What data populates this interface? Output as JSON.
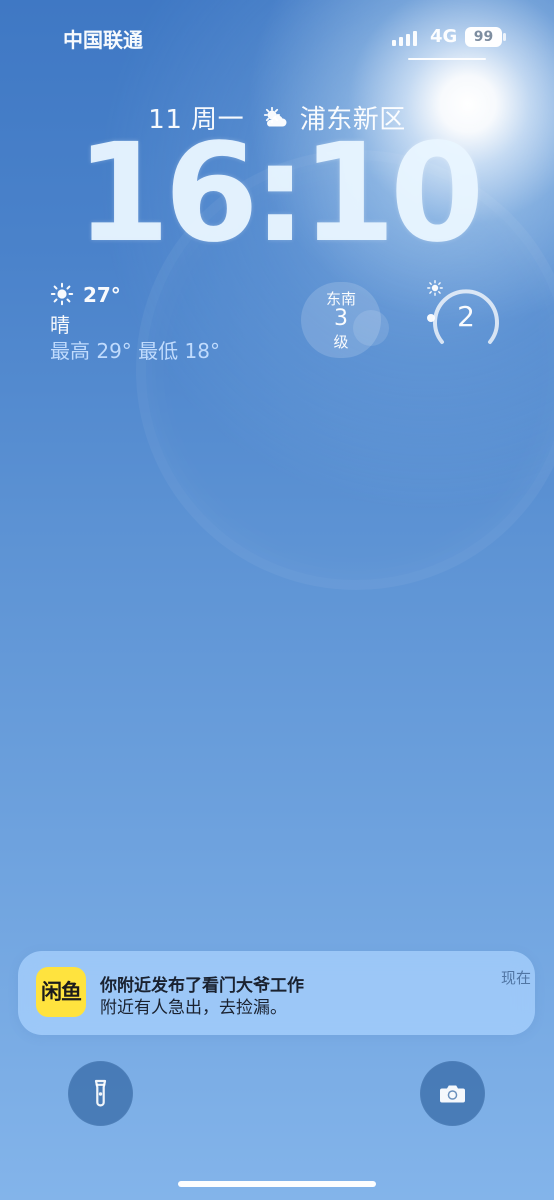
{
  "status_bar": {
    "carrier": "中国联通",
    "network": "4G",
    "battery": "99"
  },
  "lock_screen": {
    "date": "11 周一",
    "location": "浦东新区",
    "time": "16:10"
  },
  "widgets": {
    "weather": {
      "temperature": "27°",
      "condition": "晴",
      "range": "最高 29° 最低 18°",
      "icon": "sun-icon"
    },
    "wind": {
      "direction": "东南",
      "level": "3",
      "unit": "级"
    },
    "uv": {
      "value": "2"
    }
  },
  "notification": {
    "app_icon_text": "闲鱼",
    "title": "你附近发布了看门大爷工作",
    "body": "附近有人急出，去捡漏。",
    "time": "现在"
  },
  "controls": {
    "flashlight_icon": "flashlight-icon",
    "camera_icon": "camera-icon"
  },
  "colors": {
    "notification_icon": "#ffe33e",
    "background_top": "#3f78c4",
    "background_bottom": "#83b4ea"
  }
}
